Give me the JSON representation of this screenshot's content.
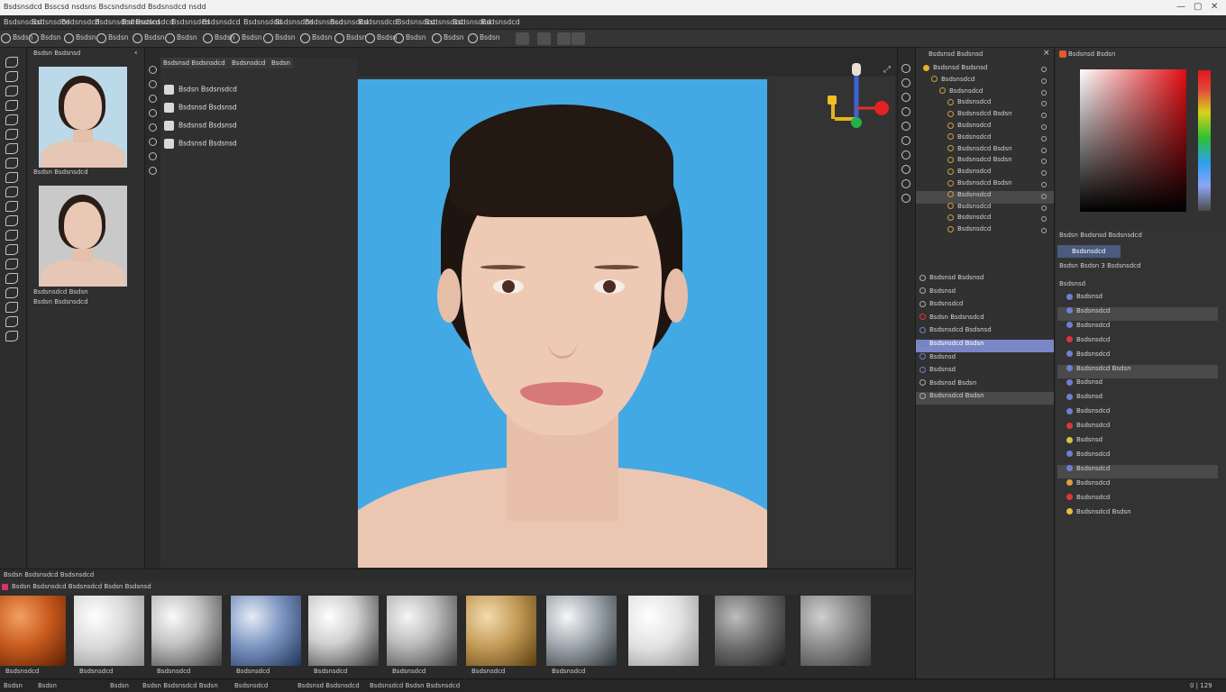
{
  "window": {
    "title": "Bsdsnsdcd Bsscsd nsdsns Bscsndsnsdd Bsdsnsdcd nsdd",
    "controls": [
      "—",
      "▢",
      "✕"
    ]
  },
  "menu": [
    "Bsdsnsdcd",
    "Bsdsnsdcd",
    "Bsdsnsdcd",
    "Bsdsnsdcd Bsdsnsdcd",
    "Bsdsnsdcd",
    "Bsdsnsdcd",
    "Bsdsnsdcd",
    "Bsdsnsdcd",
    "Bsdsnsdcd",
    "Bsdsnsdcd",
    "Bsdsnsdcd",
    "Bsdsnsdcd",
    "Bsdsnsdcd",
    "Bsdsnsdcd",
    "Bsdsnsdcd",
    "Bsdsnsdcd"
  ],
  "toolbar": [
    "Bsdsn",
    "Bsdsn",
    "Bsdsn",
    "Bsdsn",
    "Bsdsn",
    "Bsdsn",
    "Bsdsn",
    "Bsdsn",
    "Bsdsn",
    "Bsdsn",
    "Bsdsn",
    "Bsdsn",
    "Bsdsn",
    "Bsdsn",
    "Bsdsn"
  ],
  "history": {
    "header": "Bsdsn Bsdsnsd",
    "items": [
      {
        "caption": "Bsdsn Bsdsnsdcd"
      },
      {
        "caption": "Bsdsnsdcd Bsdsn"
      }
    ],
    "caption3": "Bsdsn Bsdsnsdcd"
  },
  "actions": {
    "tabs": [
      "Bsdsnsd Bsdsnsdcd",
      "Bsdsnsdcd",
      "Bsdsn"
    ],
    "rows": [
      "Bsdsn Bsdsnsdcd",
      "Bsdsnsd Bsdsnsd",
      "Bsdsnsd Bsdsnsd",
      "Bsdsnsd Bsdsnsd"
    ]
  },
  "layers": {
    "header": "Bsdsnsd Bsdsnsd",
    "rows": [
      {
        "label": "Bsdsnsd Bsdsnsd",
        "indent": 0
      },
      {
        "label": "Bsdsnsdcd",
        "indent": 1
      },
      {
        "label": "Bsdsnsdcd",
        "indent": 2
      },
      {
        "label": "Bsdsnsdcd",
        "indent": 3
      },
      {
        "label": "Bsdsnsdcd Bsdsn",
        "indent": 3
      },
      {
        "label": "Bsdsnsdcd",
        "indent": 3
      },
      {
        "label": "Bsdsnsdcd",
        "indent": 3
      },
      {
        "label": "Bsdsnsdcd Bsdsn",
        "indent": 3
      },
      {
        "label": "Bsdsnsdcd Bsdsn",
        "indent": 3
      },
      {
        "label": "Bsdsnsdcd",
        "indent": 3
      },
      {
        "label": "Bsdsnsdcd Bsdsn",
        "indent": 3
      },
      {
        "label": "Bsdsnsdcd",
        "indent": 3
      },
      {
        "label": "Bsdsnsdcd",
        "indent": 3
      },
      {
        "label": "Bsdsnsdcd",
        "indent": 3
      },
      {
        "label": "Bsdsnsdcd",
        "indent": 3
      }
    ],
    "lower_rows": [
      {
        "label": "Bsdsnsd Bsdsnsd"
      },
      {
        "label": "Bsdsnsd"
      },
      {
        "label": "Bsdsnsdcd"
      },
      {
        "label": "Bsdsn Bsdsnsdcd"
      },
      {
        "label": "Bsdsnsdcd Bsdsnsd"
      },
      {
        "label": "Bsdsnsdcd Bsdsn"
      },
      {
        "label": "Bsdsnsd"
      },
      {
        "label": "Bsdsnsd"
      },
      {
        "label": "Bsdsnsd Bsdsn"
      },
      {
        "label": "Bsdsnsdcd Bsdsn"
      }
    ]
  },
  "color": {
    "header": "Bsdsnsd Bsdsn",
    "hue_colors": [
      "#e3161c",
      "#d8d21a",
      "#2fc033",
      "#2d9ff0",
      "#8fa5f5"
    ]
  },
  "properties": {
    "header": "Bsdsn Bsdsnsd Bsdsnsdcd",
    "tab": "Bsdsnsdcd",
    "subheader": "Bsdsn Bsdsn 3 Bsdsnsdcd",
    "section": "Bsdsnsd",
    "rows": [
      {
        "label": "Bsdsnsd",
        "color": "#6d7fd0"
      },
      {
        "label": "Bsdsnsdcd",
        "color": "#6d7fd0"
      },
      {
        "label": "Bsdsnsdcd",
        "color": "#6d7fd0"
      },
      {
        "label": "Bsdsnsdcd",
        "color": "#e0343a"
      },
      {
        "label": "Bsdsnsdcd",
        "color": "#6d7fd0"
      },
      {
        "label": "Bsdsnsdcd Bsdsn",
        "color": "#6d7fd0"
      },
      {
        "label": "Bsdsnsd",
        "color": "#6d7fd0"
      },
      {
        "label": "Bsdsnsd",
        "color": "#6d7fd0"
      },
      {
        "label": "Bsdsnsdcd",
        "color": "#6d7fd0"
      },
      {
        "label": "Bsdsnsdcd",
        "color": "#e0343a"
      },
      {
        "label": "Bsdsnsd",
        "color": "#d8c340"
      },
      {
        "label": "Bsdsnsdcd",
        "color": "#6d7fd0"
      },
      {
        "label": "Bsdsnsdcd",
        "color": "#6d7fd0"
      },
      {
        "label": "Bsdsnsdcd",
        "color": "#e0a040"
      },
      {
        "label": "Bsdsnsdcd",
        "color": "#e0343a"
      },
      {
        "label": "Bsdsnsdcd Bsdsn",
        "color": "#e0c040"
      }
    ]
  },
  "materials": {
    "header": "Bsdsn Bsdsnsdcd Bsdsnsdcd",
    "bar_label": "Bsdsn Bsdsnsdcd Bsdsnsdcd Bsdsn Bsdsnsd",
    "items": [
      {
        "label": "Bsdsnsdcd",
        "style": "radial-gradient(circle at 30% 30%, #f3a063 0%, #c85a1d 45%, #5b1f05 100%)"
      },
      {
        "label": "Bsdsnsdcd",
        "style": "radial-gradient(circle at 30% 30%, #ffffff 0%, #d9d9d9 45%, #8a8a8a 100%)"
      },
      {
        "label": "Bsdsnsdcd",
        "style": "radial-gradient(circle at 30% 30%, #fafafa 0%, #c2c2c2 40%, #3c3c3c 100%)"
      },
      {
        "label": "Bsdsnsdcd",
        "style": "radial-gradient(circle at 30% 30%, #e5ecf6 0%, #7a93c0 45%, #1f3358 100%)"
      },
      {
        "label": "Bsdsnsdcd",
        "style": "radial-gradient(circle at 30% 30%, #ffffff 0%, #cfcfcf 40%, #353535 100%)"
      },
      {
        "label": "Bsdsnsdcd",
        "style": "radial-gradient(circle at 30% 30%, #f6f6f6 0%, #bdbdbd 40%, #3d3d3d 100%)"
      },
      {
        "label": "Bsdsnsdcd",
        "style": "radial-gradient(circle at 30% 30%, #f3dcb0 0%, #c39a56 45%, #5a3e10 100%)"
      },
      {
        "label": "Bsdsnsdcd",
        "style": "radial-gradient(circle at 30% 30%, #f7f7f7 0%, #9ca4ab 45%, #2b3338 100%)"
      },
      {
        "label": "",
        "style": "radial-gradient(circle at 30% 30%, #ffffff 0%, #e2e2e2 45%, #909090 100%)"
      },
      {
        "label": "",
        "style": "radial-gradient(circle at 30% 30%, #bdbdbd 0%, #6d6d6d 45%, #1d1d1d 100%)"
      },
      {
        "label": "",
        "style": "radial-gradient(circle at 30% 30%, #cfcfcf 0%, #8a8a8a 45%, #3a3a3a 100%)"
      }
    ]
  },
  "status": [
    "Bsdsn",
    "Bsdsn",
    "Bsdsn",
    "Bsdsn Bsdsnsdcd Bsdsn",
    "Bsdsnsdcd",
    "Bsdsnsd Bsdsnsdcd",
    "Bsdsnsdcd Bsdsn Bsdsnsdcd",
    "0 | 129"
  ]
}
